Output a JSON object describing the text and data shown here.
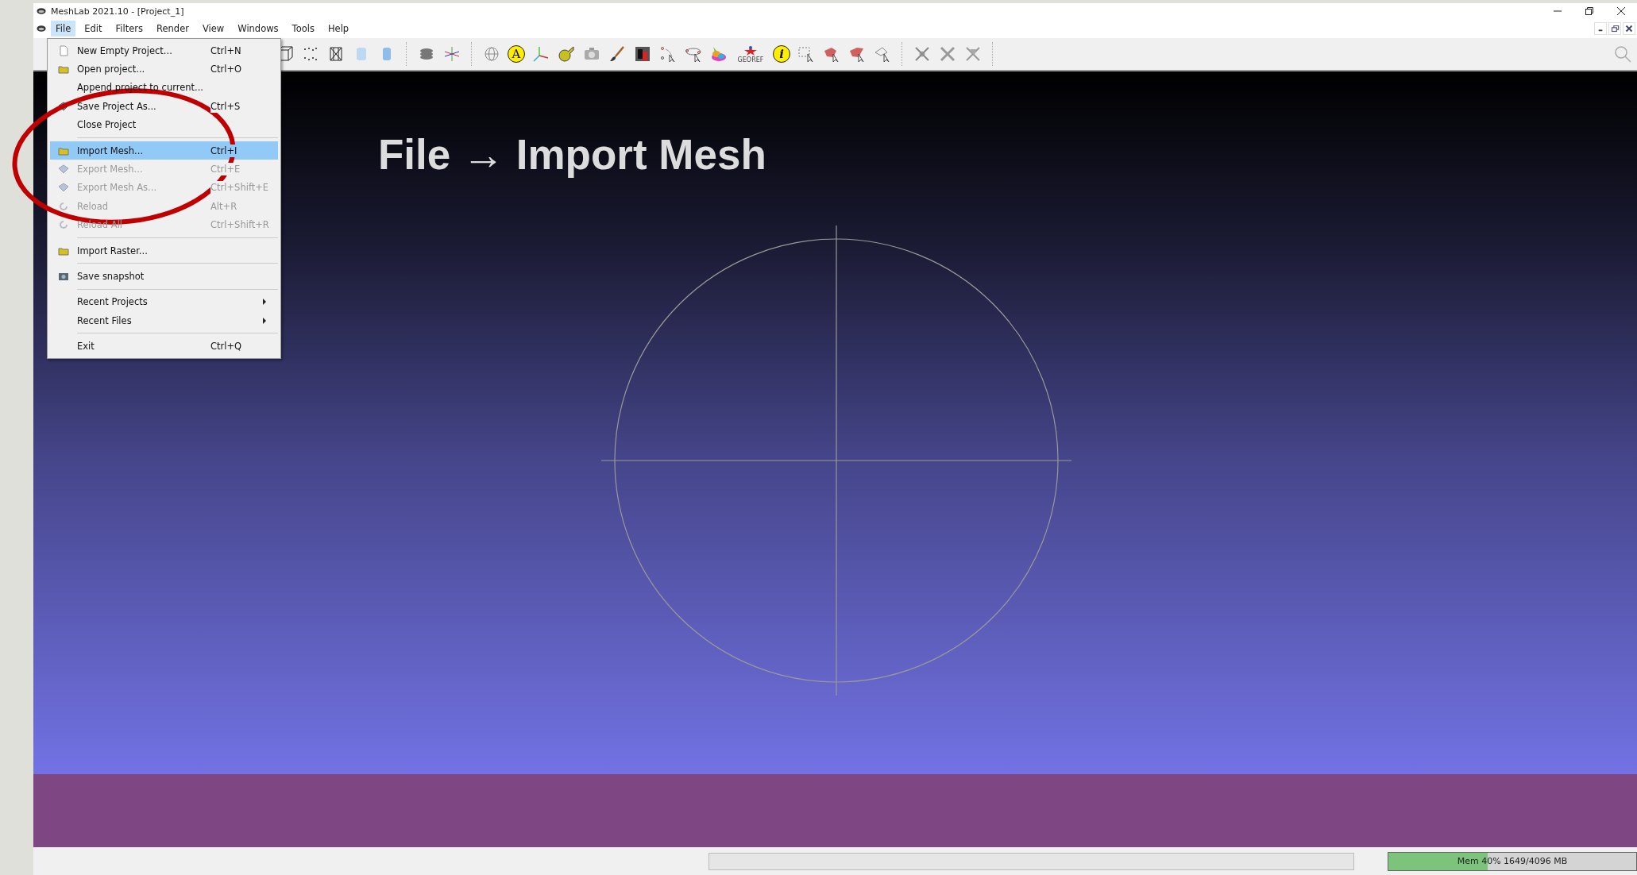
{
  "window": {
    "title": "MeshLab 2021.10 - [Project_1]"
  },
  "menu_bar": [
    {
      "label": "File",
      "selected": true
    },
    {
      "label": "Edit",
      "selected": false
    },
    {
      "label": "Filters",
      "selected": false
    },
    {
      "label": "Render",
      "selected": false
    },
    {
      "label": "View",
      "selected": false
    },
    {
      "label": "Windows",
      "selected": false
    },
    {
      "label": "Tools",
      "selected": false
    },
    {
      "label": "Help",
      "selected": false
    }
  ],
  "file_menu": [
    {
      "kind": "item",
      "label": "New Empty Project...",
      "shortcut": "Ctrl+N",
      "disabled": false,
      "selected": false
    },
    {
      "kind": "item",
      "label": "Open project...",
      "shortcut": "Ctrl+O",
      "disabled": false,
      "selected": false
    },
    {
      "kind": "item",
      "label": "Append project to current...",
      "disabled": false,
      "selected": false
    },
    {
      "kind": "item",
      "label": "Save Project As...",
      "shortcut": "Ctrl+S",
      "disabled": false,
      "selected": false
    },
    {
      "kind": "item",
      "label": "Close Project",
      "disabled": false,
      "selected": false
    },
    {
      "kind": "separator"
    },
    {
      "kind": "item",
      "label": "Import Mesh...",
      "shortcut": "Ctrl+I",
      "disabled": false,
      "selected": true
    },
    {
      "kind": "item",
      "label": "Export Mesh...",
      "shortcut": "Ctrl+E",
      "disabled": true,
      "selected": false
    },
    {
      "kind": "item",
      "label": "Export Mesh As...",
      "shortcut": "Ctrl+Shift+E",
      "disabled": true,
      "selected": false
    },
    {
      "kind": "item",
      "label": "Reload",
      "shortcut": "Alt+R",
      "disabled": true,
      "selected": false
    },
    {
      "kind": "item",
      "label": "Reload All",
      "shortcut": "Ctrl+Shift+R",
      "disabled": true,
      "selected": false
    },
    {
      "kind": "separator"
    },
    {
      "kind": "item",
      "label": "Import Raster...",
      "disabled": false,
      "selected": false
    },
    {
      "kind": "separator"
    },
    {
      "kind": "item",
      "label": "Save snapshot",
      "disabled": false,
      "selected": false
    },
    {
      "kind": "separator"
    },
    {
      "kind": "submenu",
      "label": "Recent Projects",
      "disabled": false,
      "selected": false
    },
    {
      "kind": "submenu",
      "label": "Recent Files",
      "disabled": false,
      "selected": false
    },
    {
      "kind": "separator"
    },
    {
      "kind": "item",
      "label": "Exit",
      "shortcut": "Ctrl+Q",
      "disabled": false,
      "selected": false
    }
  ],
  "toolbar": {
    "annotation_label": "A",
    "info_label": "i",
    "georef_label": "GEOREF"
  },
  "viewport": {
    "caption": "File → Import Mesh"
  },
  "status_bar": {
    "progress": {
      "level": 0
    },
    "memory": {
      "reading": "Mem 40% 1649/4096 MB",
      "level": 0.4
    }
  }
}
